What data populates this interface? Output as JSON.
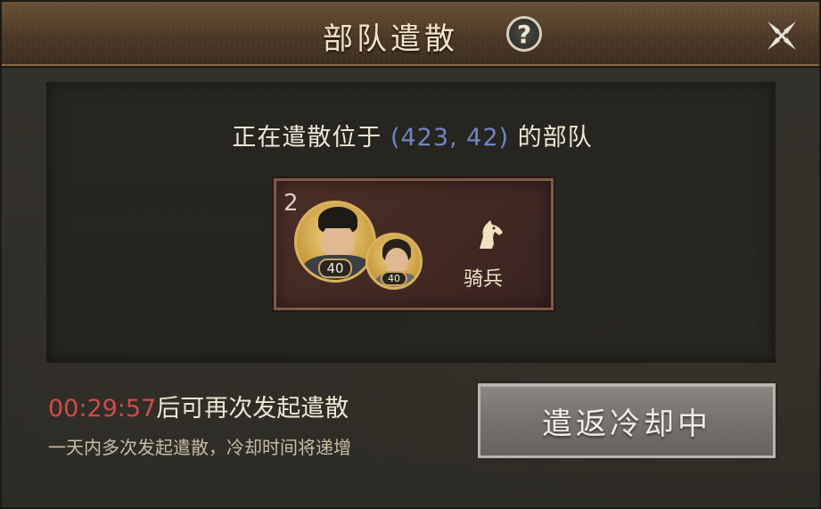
{
  "dialog": {
    "title": "部队遣散",
    "help_label": "?"
  },
  "location": {
    "prefix": "正在遣散位于",
    "coords": "(423, 42)",
    "suffix": "的部队"
  },
  "troop": {
    "count": "2",
    "main_level": "40",
    "vice_level": "40",
    "type": "骑兵",
    "type_icon": "horse-icon"
  },
  "cooldown": {
    "time": "00:29:57",
    "text": "后可再次发起遣散",
    "hint": "一天内多次发起遣散，冷却时间将递增"
  },
  "button": {
    "label": "遣返冷却中"
  },
  "colors": {
    "coords": "#6f86c4",
    "timer": "#d24a47",
    "header": "#4c3927"
  }
}
